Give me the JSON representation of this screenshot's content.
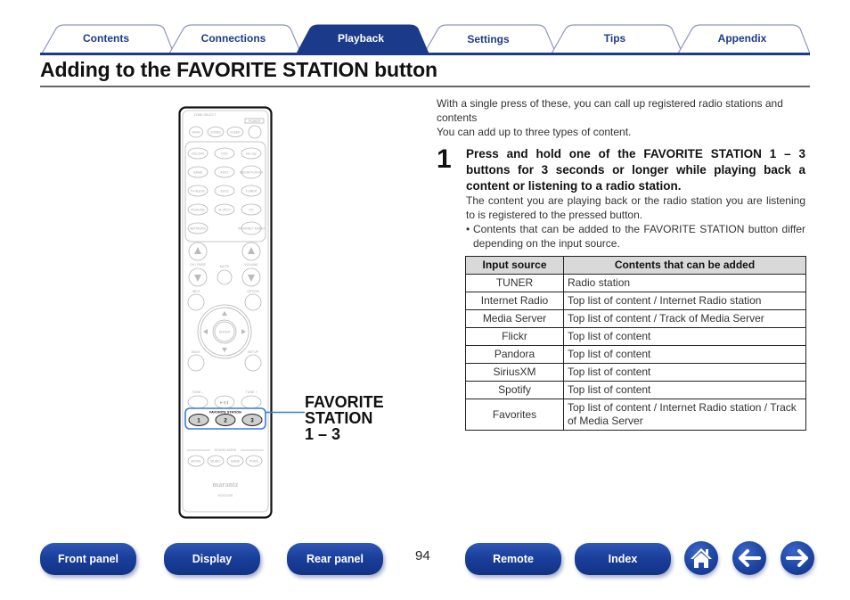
{
  "tabs": [
    {
      "label": "Contents",
      "active": false
    },
    {
      "label": "Connections",
      "active": false
    },
    {
      "label": "Playback",
      "active": true
    },
    {
      "label": "Settings",
      "active": false
    },
    {
      "label": "Tips",
      "active": false
    },
    {
      "label": "Appendix",
      "active": false
    }
  ],
  "page": {
    "title": "Adding to the FAVORITE STATION button",
    "intro": [
      "With a single press of these, you can call up registered radio stations and contents",
      "You can add up to three types of content."
    ],
    "step": {
      "number": "1",
      "heading": "Press and hold one of the FAVORITE STATION 1 – 3 buttons for 3 seconds or longer while playing back a content or listening to a radio station.",
      "body": "The content you are playing back or the radio station you are listening to is registered to the pressed button.",
      "bullet_mark": "•",
      "bullet": "Contents that can be added to the FAVORITE STATION button differ depending on the input source."
    },
    "callout": [
      "FAVORITE",
      "STATION",
      "1 – 3"
    ]
  },
  "table": {
    "headers": [
      "Input source",
      "Contents that can be added"
    ],
    "rows": [
      [
        "TUNER",
        "Radio station"
      ],
      [
        "Internet Radio",
        "Top list of content / Internet Radio station"
      ],
      [
        "Media Server",
        "Top list of content / Track of Media Server"
      ],
      [
        "Flickr",
        "Top list of content"
      ],
      [
        "Pandora",
        "Top list of content"
      ],
      [
        "SiriusXM",
        "Top list of content"
      ],
      [
        "Spotify",
        "Top list of content"
      ],
      [
        "Favorites",
        "Top list of content / Internet Radio station / Track of Media Server"
      ]
    ]
  },
  "remote": {
    "zone_select": "ZONE SELECT",
    "power": "POWER",
    "zone_buttons": [
      "MAIN",
      "ZONE2",
      "SLEEP"
    ],
    "source_buttons": [
      "CBL/SAT",
      "DVD",
      "Blu-ray",
      "GAME",
      "AUX1",
      "MEDIA PLAYER",
      "TV AUDIO",
      "AUX2",
      "TUNER",
      "iPod/USB",
      "M-XPort",
      "CD",
      "NETWORK",
      "",
      "INTERNET RADIO"
    ],
    "ch_page": "CH / PAGE",
    "mute": "MUTE",
    "volume": "VOLUME",
    "info": "INFO",
    "option": "OPTION",
    "enter": "ENTER",
    "back": "BACK",
    "setup": "SETUP",
    "tune_minus": "TUNE –",
    "tune_plus": "TUNE +",
    "play_pause": "▶/❚❚",
    "favorite_station": "FAVORITE STATION",
    "favorite_buttons": [
      "1",
      "2",
      "3"
    ],
    "sound_mode": "SOUND MODE",
    "sound_buttons": [
      "MOVIE",
      "MUSIC",
      "GAME",
      "PURE"
    ],
    "brand": "marantz",
    "model": "RC021SR"
  },
  "colors": {
    "brand_blue": "#1b3a8a",
    "highlight": "#3a7bd5"
  },
  "footer": {
    "buttons": [
      "Front panel",
      "Display",
      "Rear panel",
      "Remote",
      "Index"
    ],
    "page_number": "94",
    "icons": [
      "home-icon",
      "back-arrow-icon",
      "forward-arrow-icon"
    ]
  }
}
